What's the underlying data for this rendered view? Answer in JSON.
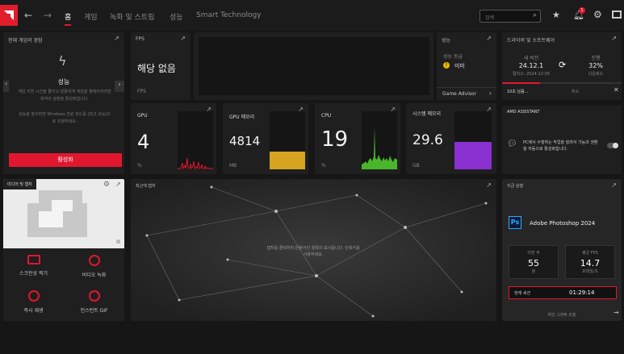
{
  "topbar": {
    "home_label": "홈",
    "tabs": [
      "게임",
      "녹화 및 스트림",
      "성능",
      "Smart Technology"
    ],
    "search_placeholder": "검색",
    "notification_count": "1"
  },
  "game_panel": {
    "title": "현재 게임의 경험",
    "heading": "성능",
    "desc1": "게임 지연 시간을 줄이고 원활하게 게임을 플레이하려면 최적의 설정을 활성화합니다.",
    "desc2": "성능을 높이려면 Windows 전원 모드를 [최고 성능]으로 조정하세요.",
    "activate_label": "활성화"
  },
  "fps_panel": {
    "label": "FPS",
    "value": "해당 없음",
    "unit": "FPS"
  },
  "perf_panel": {
    "title": "성능",
    "grade_label": "성능 등급",
    "grade_value": "미미",
    "advisor_label": "Game Advisor"
  },
  "driver_panel": {
    "title": "드라이버 및 소프트웨어",
    "current_label": "새 버전",
    "version": "24.12.1",
    "release_date": "릴리스: 2024-12-05",
    "progress_label": "진행",
    "progress_value": "32%",
    "progress_status": "다운로드",
    "row_text": "10초 남음...",
    "cancel_label": "취소"
  },
  "metrics": [
    {
      "label": "GPU",
      "value": "4",
      "unit": "%",
      "color": "#e0172f"
    },
    {
      "label": "GPU 메모리",
      "value": "4814",
      "unit": "MB",
      "color": "#d6a420"
    },
    {
      "label": "CPU",
      "value": "19",
      "unit": "%",
      "color": "#49b52a"
    },
    {
      "label": "시스템 메모리",
      "value": "29.6",
      "unit": "GB",
      "color": "#8a2fd0"
    }
  ],
  "assistant": {
    "title": "AMD ASSISTANT",
    "text": "PC에서 수행하는 작업을 빌려서 기능과 권환을 자동으로 활성화합니다."
  },
  "media": {
    "title": "미디어 및 캡처",
    "actions": [
      "스크린샷 찍기",
      "비디오 녹화",
      "즉시 재생",
      "인스턴트 GIF"
    ]
  },
  "recent_capture": {
    "title": "최근에 캡처",
    "empty_text": "캡처를 클릭하여 만들어진 항목이 표시됩니다. 단축키를 사용하세요."
  },
  "app_panel": {
    "title": "지금 실행",
    "app_icon": "Ps",
    "app_name": "Adobe Photoshop 2024",
    "stat1_label": "이번 주",
    "stat1_value": "55",
    "stat1_unit": "분",
    "stat2_label": "평균 FPS",
    "stat2_value": "14.7",
    "stat2_unit": "프레임/초",
    "session_label": "현재 세션",
    "session_value": "01:29:14",
    "footer_label": "게임 그래픽 조정"
  },
  "colors": {
    "accent": "#e0172f",
    "gpu_mem": "#d6a420",
    "cpu": "#49b52a",
    "sys_mem": "#8a2fd0"
  }
}
